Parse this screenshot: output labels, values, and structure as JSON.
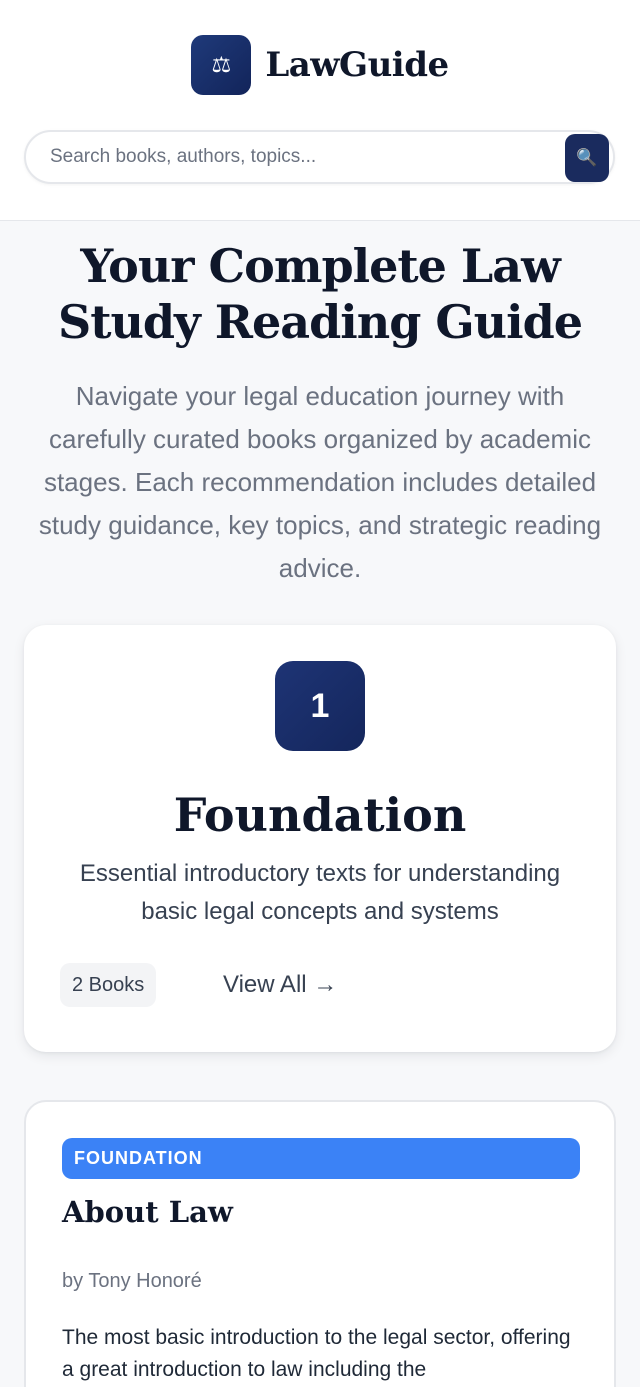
{
  "header": {
    "logo_icon": "scales-icon",
    "logo_glyph": "⚖",
    "brand_name": "LawGuide",
    "accent_color": "#1a2b5e"
  },
  "search": {
    "placeholder": "Search books, authors, topics...",
    "value": "",
    "button_icon": "search-icon",
    "button_glyph": "🔍"
  },
  "hero": {
    "title": "Your Complete Law Study Reading Guide",
    "subtitle": "Navigate your legal education journey with carefully curated books organized by academic stages. Each recommendation includes detailed study guidance, key topics, and strategic reading advice."
  },
  "stage": {
    "number": "1",
    "title": "Foundation",
    "description": "Essential introductory texts for understanding basic legal concepts and systems",
    "count_label": "2 Books",
    "view_all_label": "View All →"
  },
  "book": {
    "tag": "FOUNDATION",
    "tag_color": "#3b82f6",
    "title": "About Law",
    "author": "by Tony Honoré",
    "description": "The most basic introduction to the legal sector, offering a great introduction to law including the"
  }
}
